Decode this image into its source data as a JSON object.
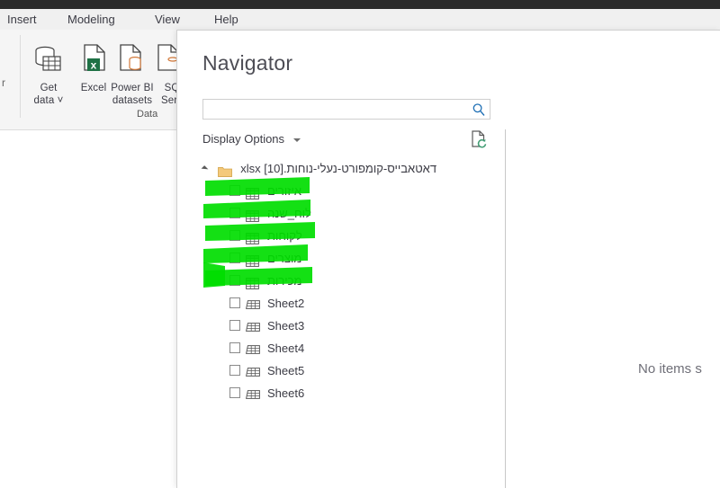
{
  "app": {
    "titlebar_color": "#2b2b2b",
    "menu": [
      {
        "label": "Insert"
      },
      {
        "label": "Modeling"
      },
      {
        "label": "View"
      },
      {
        "label": "Help"
      }
    ],
    "ribbon": {
      "left_fragment": "r",
      "group_label": "Data",
      "buttons": [
        {
          "icon": "get-data-icon",
          "line1": "Get",
          "line2": "data ˅"
        },
        {
          "icon": "excel-icon",
          "line1": "Excel",
          "line2": ""
        },
        {
          "icon": "power-bi-datasets-icon",
          "line1": "Power BI",
          "line2": "datasets"
        },
        {
          "icon": "sql-server-icon",
          "line1": "SQ",
          "line2": "Serv"
        }
      ]
    }
  },
  "dialog": {
    "title": "Navigator",
    "search": {
      "value": "",
      "placeholder": "",
      "icon": "search-icon"
    },
    "display_options": {
      "label": "Display Options",
      "caret": "chevron-down-icon"
    },
    "refresh_icon": "refresh-document-icon",
    "tree": {
      "root": {
        "label": "דאטאבייס-קומפורט-נעלי-נוחות.xlsx [10]",
        "expanded": true,
        "icon": "folder-icon"
      },
      "items": [
        {
          "label": "איזורים",
          "icon": "table-icon",
          "checked": false,
          "rtl": true,
          "highlighted": true
        },
        {
          "label": "לוח_שנה",
          "icon": "table-icon",
          "checked": false,
          "rtl": true,
          "highlighted": true
        },
        {
          "label": "לקוחות",
          "icon": "table-icon",
          "checked": false,
          "rtl": true,
          "highlighted": true
        },
        {
          "label": "מוצרים",
          "icon": "table-icon",
          "checked": false,
          "rtl": true,
          "highlighted": true
        },
        {
          "label": "מכירות",
          "icon": "table-icon",
          "checked": false,
          "rtl": true,
          "highlighted": true
        },
        {
          "label": "Sheet2",
          "icon": "sheet-icon",
          "checked": false,
          "rtl": false,
          "highlighted": false
        },
        {
          "label": "Sheet3",
          "icon": "sheet-icon",
          "checked": false,
          "rtl": false,
          "highlighted": false
        },
        {
          "label": "Sheet4",
          "icon": "sheet-icon",
          "checked": false,
          "rtl": false,
          "highlighted": false
        },
        {
          "label": "Sheet5",
          "icon": "sheet-icon",
          "checked": false,
          "rtl": false,
          "highlighted": false
        },
        {
          "label": "Sheet6",
          "icon": "sheet-icon",
          "checked": false,
          "rtl": false,
          "highlighted": false
        }
      ]
    },
    "preview": {
      "empty_message": "No items s"
    }
  },
  "annotation": {
    "highlight_color": "#00dd00",
    "tool": "green-highlighter-marker",
    "stroke_count": 5
  }
}
